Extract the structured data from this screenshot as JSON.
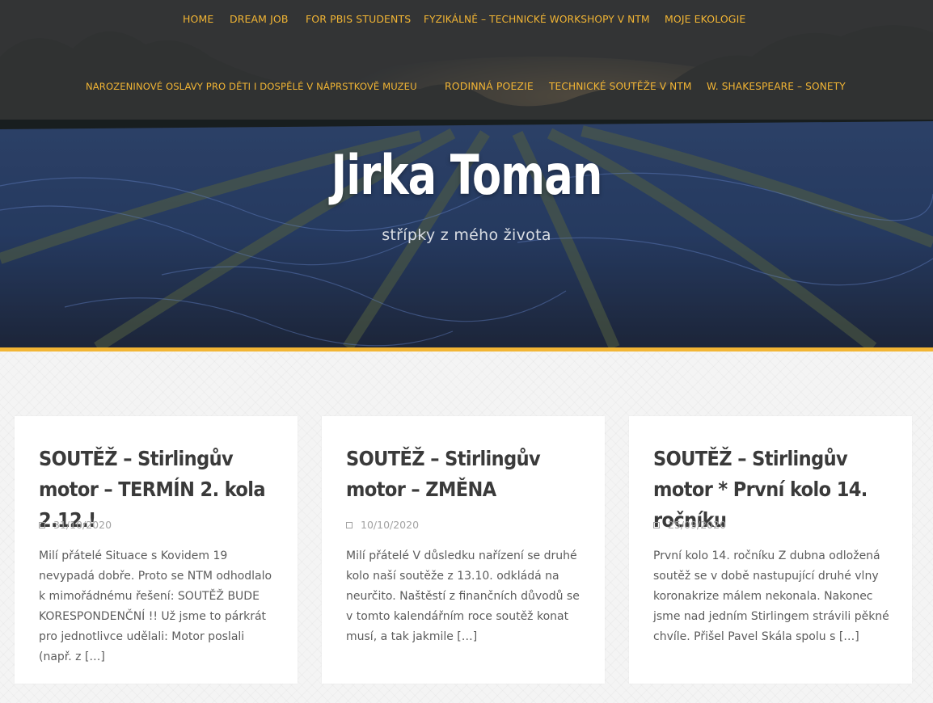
{
  "nav": {
    "row1": [
      "HOME",
      "DREAM JOB",
      "FOR PBIS STUDENTS",
      "FYZIKÁLNĚ – TECHNICKÉ WORKSHOPY V NTM",
      "MOJE EKOLOGIE"
    ],
    "row2": [
      "NAROZENINOVÉ OSLAVY PRO DĚTI I DOSPĚLÉ V NÁPRSTKOVĚ MUZEU",
      "RODINNÁ POEZIE",
      "TECHNICKÉ SOUTĚŽE V NTM",
      "W. SHAKESPEARE – SONETY"
    ]
  },
  "site": {
    "title": "Jirka Toman",
    "description": "střípky z mého života"
  },
  "colors": {
    "accent": "#f2b534",
    "card_title": "#3a3a3a",
    "text": "#5c5c5c"
  },
  "posts": [
    {
      "title": "SOUTĚŽ – Stirlingův motor – TERMÍN 2. kola 2.12.!",
      "date": "31/10/2020",
      "excerpt": "Milí přátelé Situace s Kovidem 19 nevypadá dobře. Proto se NTM odhodlalo k mimořádnému řešení: SOUTĚŽ BUDE KORESPONDENČNÍ !! Už jsme to párkrát pro jednotlivce udělali: Motor poslali (např. z […]"
    },
    {
      "title": "SOUTĚŽ – Stirlingův motor – ZMĚNA",
      "date": "10/10/2020",
      "excerpt": "Milí přátelé V důsledku nařízení se druhé kolo naší soutěže z 13.10. odkládá na neurčito. Naštěstí z finančních důvodů se v tomto kalendářním roce soutěž konat musí, a tak jakmile […]"
    },
    {
      "title": "SOUTĚŽ – Stirlingův motor * První kolo 14. ročníku",
      "date": "25/09/2020",
      "excerpt": "První kolo 14. ročníku Z dubna odložená soutěž se v době nastupující druhé vlny koronakrize málem nekonala. Nakonec jsme nad jedním Stirlingem strávili pěkné chvíle. Přišel Pavel Skála spolu s […]"
    }
  ]
}
